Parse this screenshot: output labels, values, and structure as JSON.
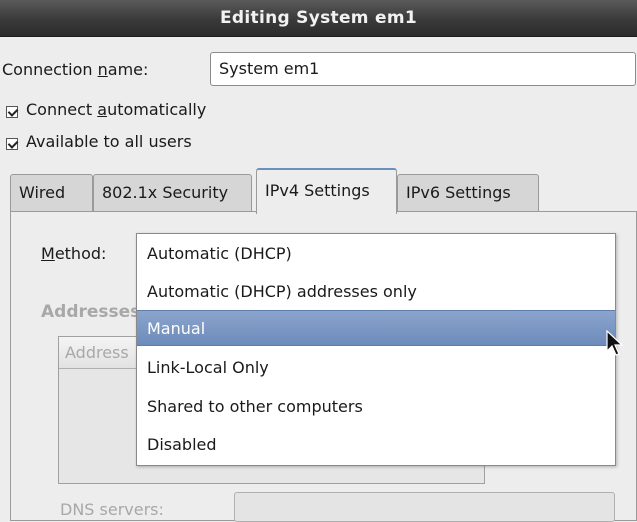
{
  "window": {
    "title": "Editing System em1"
  },
  "connection": {
    "name_label_pre": "Connection ",
    "name_label_mnemonic": "n",
    "name_label_post": "ame:",
    "name_value": "System em1"
  },
  "checkboxes": [
    {
      "pre": "Connect ",
      "mnemonic": "a",
      "post": "utomatically",
      "checked": true
    },
    {
      "pre": "Available to all users",
      "mnemonic": "",
      "post": "",
      "checked": true
    }
  ],
  "tabs": [
    {
      "label": "Wired"
    },
    {
      "label": "802.1x Security"
    },
    {
      "label": "IPv4 Settings",
      "active": true
    },
    {
      "label": "IPv6 Settings"
    }
  ],
  "ipv4": {
    "method_mnemonic": "M",
    "method_rest": "ethod:",
    "addresses_heading": "Addresses",
    "address_column": "Address",
    "dns_label": "DNS servers:"
  },
  "method_dropdown": {
    "selected": "Manual",
    "options": [
      "Automatic (DHCP)",
      "Automatic (DHCP) addresses only",
      "Manual",
      "Link-Local Only",
      "Shared to other computers",
      "Disabled"
    ]
  },
  "colors": {
    "selection": "#7892be",
    "title_bar": "#3a3a3a",
    "tab_active_accent": "#6d8fc0"
  }
}
